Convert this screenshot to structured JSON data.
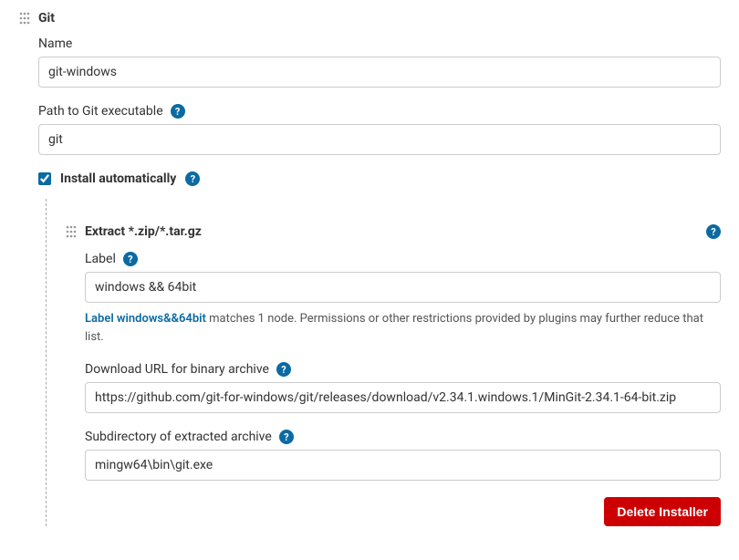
{
  "section": {
    "title": "Git"
  },
  "fields": {
    "name": {
      "label": "Name",
      "value": "git-windows"
    },
    "path": {
      "label": "Path to Git executable",
      "value": "git"
    },
    "install_auto": {
      "label": "Install automatically",
      "checked": true
    }
  },
  "installer": {
    "title": "Extract *.zip/*.tar.gz",
    "label": {
      "label": "Label",
      "value": "windows && 64bit",
      "help_link_text": "Label windows&&64bit",
      "help_text": " matches 1 node. Permissions or other restrictions provided by plugins may further reduce that list."
    },
    "download_url": {
      "label": "Download URL for binary archive",
      "value": "https://github.com/git-for-windows/git/releases/download/v2.34.1.windows.1/MinGit-2.34.1-64-bit.zip"
    },
    "subdirectory": {
      "label": "Subdirectory of extracted archive",
      "value": "mingw64\\bin\\git.exe"
    },
    "delete_button": "Delete Installer"
  }
}
